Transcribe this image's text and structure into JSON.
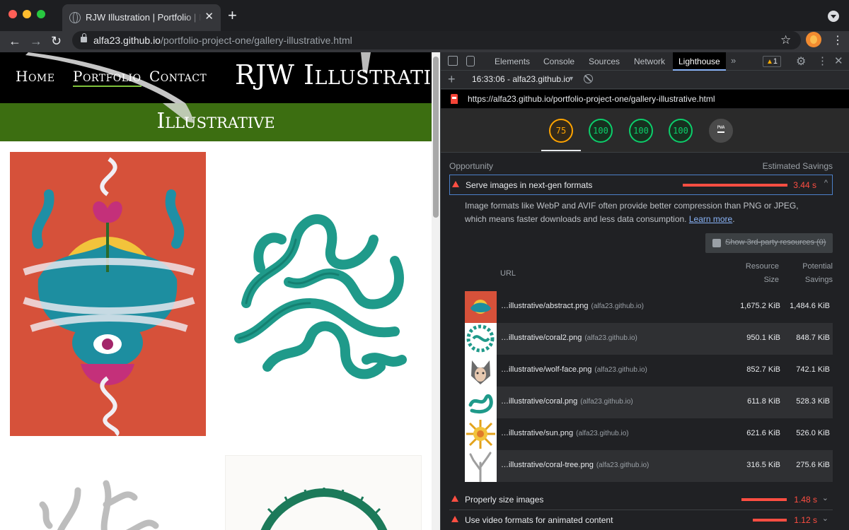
{
  "browser": {
    "tab_title": "RJW Illustration | Portfolio | Illustrative",
    "tab_close": "✕",
    "new_tab": "+",
    "url_host": "alfa23.github.io",
    "url_path": "/portfolio-project-one/gallery-illustrative.html"
  },
  "site": {
    "nav": [
      "Home",
      "Portfolio",
      "Contact"
    ],
    "active_nav": "Portfolio",
    "brand": "RJW Illustration",
    "section_title": "Illustrative"
  },
  "devtools": {
    "tabs": [
      "Elements",
      "Console",
      "Sources",
      "Network",
      "Lighthouse"
    ],
    "active_tab": "Lighthouse",
    "more": "»",
    "warnings": "1",
    "report_label": "16:33:06 - alfa23.github.io",
    "report_url": "https://alfa23.github.io/portfolio-project-one/gallery-illustrative.html",
    "scores": [
      {
        "value": "75",
        "status": "average",
        "color": "#ffa400"
      },
      {
        "value": "100",
        "status": "pass",
        "color": "#0cce6b"
      },
      {
        "value": "100",
        "status": "pass",
        "color": "#0cce6b"
      },
      {
        "value": "100",
        "status": "pass",
        "color": "#0cce6b"
      }
    ],
    "pwa_label": "PWA",
    "opportunity_label": "Opportunity",
    "estimated_savings_label": "Estimated Savings",
    "audits": [
      {
        "title": "Serve images in next-gen formats",
        "savings": "3.44 s",
        "chevron": "^"
      },
      {
        "title": "Properly size images",
        "savings": "1.48 s",
        "chevron": "⌄"
      },
      {
        "title": "Use video formats for animated content",
        "savings": "1.12 s",
        "chevron": "⌄"
      }
    ],
    "description": "Image formats like WebP and AVIF often provide better compression than PNG or JPEG, which means faster downloads and less data consumption.",
    "learn_more": "Learn more",
    "third_party_label": "Show 3rd-party resources",
    "third_party_count": "(0)",
    "columns": {
      "url": "URL",
      "resource_size_1": "Resource",
      "resource_size_2": "Size",
      "potential_savings_1": "Potential",
      "potential_savings_2": "Savings"
    },
    "rows": [
      {
        "name": "…illustrative/abstract.png",
        "host": "(alfa23.github.io)",
        "size": "1,675.2 KiB",
        "savings": "1,484.6 KiB",
        "thumb": "abstract-icon"
      },
      {
        "name": "…illustrative/coral2.png",
        "host": "(alfa23.github.io)",
        "size": "950.1 KiB",
        "savings": "848.7 KiB",
        "thumb": "coral2-icon"
      },
      {
        "name": "…illustrative/wolf-face.png",
        "host": "(alfa23.github.io)",
        "size": "852.7 KiB",
        "savings": "742.1 KiB",
        "thumb": "wolf-face-icon"
      },
      {
        "name": "…illustrative/coral.png",
        "host": "(alfa23.github.io)",
        "size": "611.8 KiB",
        "savings": "528.3 KiB",
        "thumb": "coral-icon"
      },
      {
        "name": "…illustrative/sun.png",
        "host": "(alfa23.github.io)",
        "size": "621.6 KiB",
        "savings": "526.0 KiB",
        "thumb": "sun-icon"
      },
      {
        "name": "…illustrative/coral-tree.png",
        "host": "(alfa23.github.io)",
        "size": "316.5 KiB",
        "savings": "275.6 KiB",
        "thumb": "coral-tree-icon"
      }
    ]
  }
}
